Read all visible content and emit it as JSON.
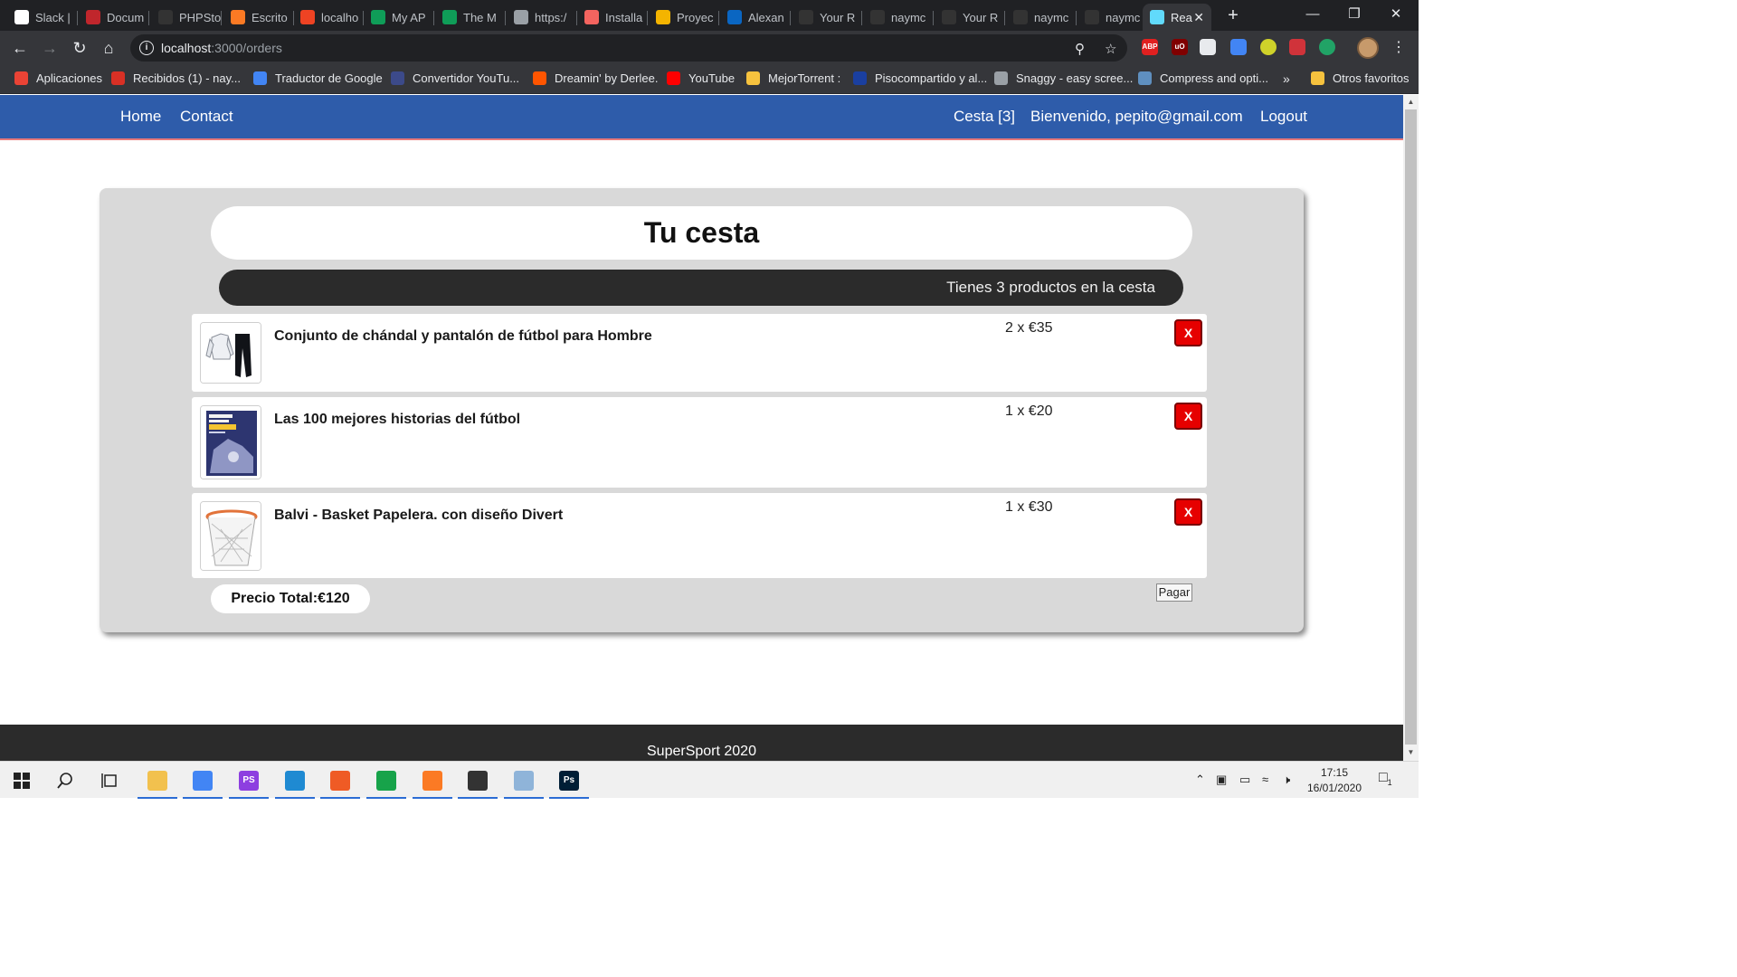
{
  "browser": {
    "tabs": [
      {
        "label": "Slack |",
        "icon": "slack-icon",
        "color": "#ffffff"
      },
      {
        "label": "Docum",
        "icon": "pdf-icon",
        "color": "#c0262c"
      },
      {
        "label": "PHPSto",
        "icon": "github-icon",
        "color": "#333333"
      },
      {
        "label": "Escrito",
        "icon": "xampp-icon",
        "color": "#fb7a24"
      },
      {
        "label": "localho",
        "icon": "codeigniter-icon",
        "color": "#ee4323"
      },
      {
        "label": "My AP",
        "icon": "api-icon",
        "color": "#0f9d58"
      },
      {
        "label": "The M",
        "icon": "api-icon",
        "color": "#0f9d58"
      },
      {
        "label": "https:/",
        "icon": "globe-icon",
        "color": "#9aa0a6"
      },
      {
        "label": "Installa",
        "icon": "laravel-icon",
        "color": "#f4645f"
      },
      {
        "label": "Proyec",
        "icon": "slides-icon",
        "color": "#f4b400"
      },
      {
        "label": "Alexan",
        "icon": "linkedin-icon",
        "color": "#0a66c2"
      },
      {
        "label": "Your R",
        "icon": "github-icon",
        "color": "#333333"
      },
      {
        "label": "naymc",
        "icon": "github-icon",
        "color": "#333333"
      },
      {
        "label": "Your R",
        "icon": "github-icon",
        "color": "#333333"
      },
      {
        "label": "naymc",
        "icon": "github-icon",
        "color": "#333333"
      },
      {
        "label": "naymc",
        "icon": "github-icon",
        "color": "#333333"
      },
      {
        "label": "Rea",
        "icon": "react-icon",
        "color": "#61dafb"
      }
    ],
    "url_host": "localhost",
    "url_path": ":3000/orders",
    "bookmarks": [
      {
        "label": "Aplicaciones",
        "color": "#ea4335"
      },
      {
        "label": "Recibidos (1) - nay...",
        "color": "#d93025"
      },
      {
        "label": "Traductor de Google",
        "color": "#4285f4"
      },
      {
        "label": "Convertidor YouTu...",
        "color": "#3c4a8a"
      },
      {
        "label": "Dreamin' by Derlee.",
        "color": "#ff5500"
      },
      {
        "label": "YouTube",
        "color": "#ff0000"
      },
      {
        "label": "MejorTorrent :",
        "color": "#f6c23e"
      },
      {
        "label": "Pisocompartido y al...",
        "color": "#1a3fa0"
      },
      {
        "label": "Snaggy - easy scree...",
        "color": "#9aa0a6"
      },
      {
        "label": "Compress and opti...",
        "color": "#5f8fbf"
      },
      {
        "label": "Otros favoritos",
        "color": "#f6c23e"
      }
    ],
    "bookmarks_overflow": "»"
  },
  "navbar": {
    "home": "Home",
    "contact": "Contact",
    "cart": "Cesta [3]",
    "welcome": "Bienvenido, pepito@gmail.com",
    "logout": "Logout",
    "bg_color": "#2e5caa"
  },
  "cart": {
    "title": "Tu cesta",
    "count_text": "Tienes 3 productos en la cesta",
    "items": [
      {
        "name": "Conjunto de chándal y pantalón de fútbol para Hombre",
        "qty_price": "2 x €35",
        "remove": "X",
        "image": "tracksuit-image"
      },
      {
        "name": "Las 100 mejores historias del fútbol",
        "qty_price": "1 x €20",
        "remove": "X",
        "image": "book-image"
      },
      {
        "name": "Balvi - Basket Papelera. con diseño Divert",
        "qty_price": "1 x €30",
        "remove": "X",
        "image": "basket-bin-image"
      }
    ],
    "total": "Precio Total:€120",
    "pay": "Pagar"
  },
  "footer": {
    "text": "SuperSport 2020"
  },
  "taskbar": {
    "time": "17:15",
    "date": "16/01/2020",
    "notification_count": "1",
    "apps": [
      {
        "name": "file-explorer",
        "label": "",
        "color": "#f2c14e"
      },
      {
        "name": "chrome",
        "label": "",
        "color": "#4285f4"
      },
      {
        "name": "phpstorm",
        "label": "PS",
        "color": "#8d3fe0"
      },
      {
        "name": "vscode",
        "label": "",
        "color": "#1f8ad2"
      },
      {
        "name": "postman",
        "label": "",
        "color": "#ef5b25"
      },
      {
        "name": "gitkraken",
        "label": "",
        "color": "#17a34a"
      },
      {
        "name": "xampp",
        "label": "",
        "color": "#fb7a24"
      },
      {
        "name": "editor",
        "label": "",
        "color": "#333333"
      },
      {
        "name": "notes",
        "label": "",
        "color": "#8fb4d9"
      },
      {
        "name": "photoshop",
        "label": "Ps",
        "color": "#001e36"
      }
    ]
  }
}
